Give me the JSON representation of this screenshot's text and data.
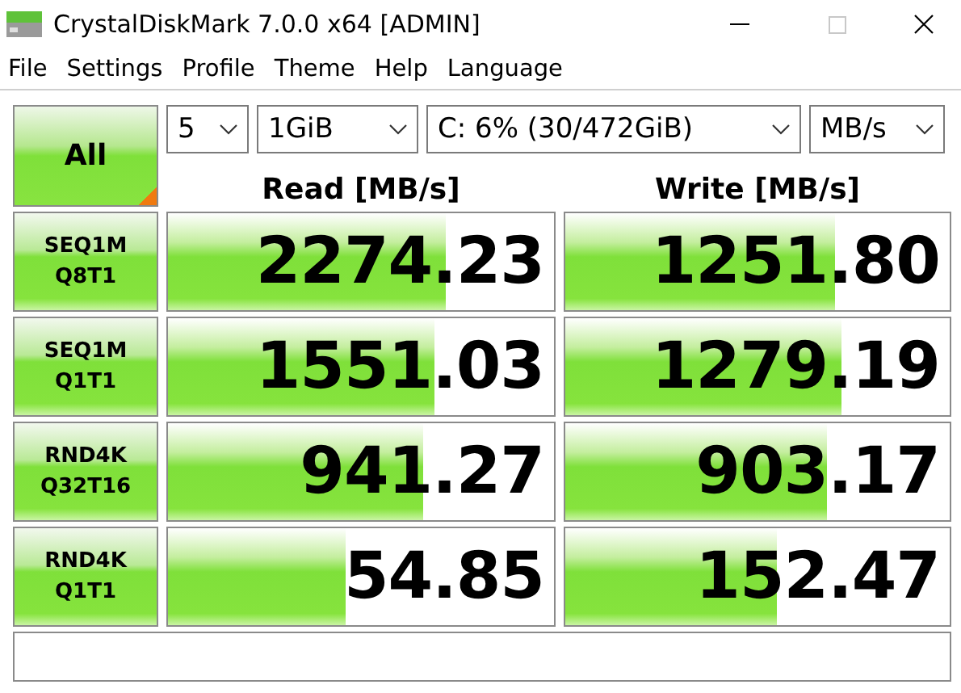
{
  "window": {
    "title": "CrystalDiskMark 7.0.0 x64 [ADMIN]"
  },
  "menu": [
    "File",
    "Settings",
    "Profile",
    "Theme",
    "Help",
    "Language"
  ],
  "all_button": {
    "label": "All"
  },
  "selects": [
    {
      "value": "5"
    },
    {
      "value": "1GiB"
    },
    {
      "value": "C: 6% (30/472GiB)"
    },
    {
      "value": "MB/s"
    }
  ],
  "columns": [
    "Read [MB/s]",
    "Write [MB/s]"
  ],
  "tests": [
    {
      "name": "SEQ1M",
      "params": "Q8T1",
      "read": {
        "value": "2274.23",
        "level": 0.72
      },
      "write": {
        "value": "1251.80",
        "level": 0.7
      }
    },
    {
      "name": "SEQ1M",
      "params": "Q1T1",
      "read": {
        "value": "1551.03",
        "level": 0.69
      },
      "write": {
        "value": "1279.19",
        "level": 0.72
      }
    },
    {
      "name": "RND4K",
      "params": "Q32T16",
      "read": {
        "value": "941.27",
        "level": 0.66
      },
      "write": {
        "value": "903.17",
        "level": 0.68
      }
    },
    {
      "name": "RND4K",
      "params": "Q1T1",
      "read": {
        "value": "54.85",
        "level": 0.46
      },
      "write": {
        "value": "152.47",
        "level": 0.55
      }
    }
  ]
}
